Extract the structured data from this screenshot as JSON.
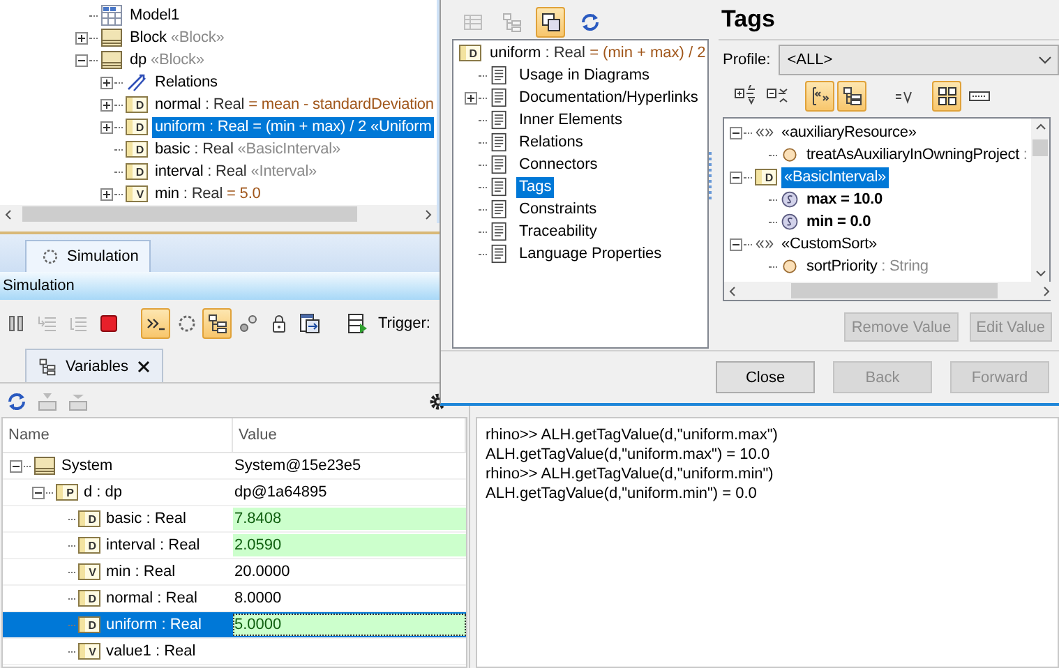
{
  "model_tree": {
    "items": [
      {
        "kind": "diagram",
        "name": "Model1",
        "selected": false
      },
      {
        "kind": "block",
        "name": "Block",
        "stereotype": "«Block»",
        "expanded": false,
        "selected": false
      },
      {
        "kind": "block",
        "name": "dp",
        "stereotype": "«Block»",
        "expanded": true,
        "selected": false,
        "children": [
          {
            "kind": "relations",
            "name": "Relations",
            "expanded": false,
            "selected": false
          },
          {
            "kind": "property",
            "icon_letter": "D",
            "name": "normal",
            "type": ": Real",
            "default": "= mean - standardDeviation",
            "expanded": false,
            "selected": false
          },
          {
            "kind": "property",
            "icon_letter": "D",
            "name": "uniform",
            "type": ": Real",
            "default": "= (min + max) / 2",
            "stereotype": "«Uniform",
            "expanded": false,
            "selected": true
          },
          {
            "kind": "property",
            "icon_letter": "D",
            "name": "basic",
            "type": ": Real",
            "stereotype": "«BasicInterval»",
            "selected": false
          },
          {
            "kind": "property",
            "icon_letter": "D",
            "name": "interval",
            "type": ": Real",
            "stereotype": "«Interval»",
            "selected": false
          },
          {
            "kind": "property",
            "icon_letter": "V",
            "name": "min",
            "type": ": Real",
            "default": "= 5.0",
            "expanded": false,
            "selected": false
          }
        ]
      }
    ]
  },
  "simulation": {
    "tab": "Simulation",
    "title": "Simulation",
    "trigger_label": "Trigger:",
    "tools": [
      {
        "kind": "pause",
        "pressed": false,
        "disabled": false
      },
      {
        "kind": "step_into",
        "pressed": false,
        "disabled": true
      },
      {
        "kind": "step_over",
        "pressed": false,
        "disabled": true
      },
      {
        "kind": "stop",
        "pressed": false,
        "disabled": false
      },
      {
        "kind": "console",
        "pressed": true,
        "disabled": false
      },
      {
        "kind": "animation",
        "pressed": false,
        "disabled": false
      },
      {
        "kind": "tree",
        "pressed": true,
        "disabled": false
      },
      {
        "kind": "breakpoints",
        "pressed": false,
        "disabled": false
      },
      {
        "kind": "lock",
        "pressed": false,
        "disabled": false
      },
      {
        "kind": "export",
        "pressed": false,
        "disabled": false
      },
      {
        "kind": "run",
        "pressed": false,
        "disabled": false
      }
    ]
  },
  "variables": {
    "tab": "Variables",
    "columns": [
      "Name",
      "Value"
    ],
    "rows": [
      {
        "kind": "block",
        "name": "System",
        "value": "System@15e23e5",
        "expanded": true,
        "changed": false,
        "selected": false,
        "children": [
          {
            "kind": "property",
            "icon_letter": "P",
            "name": "d : dp",
            "value": "dp@1a64895",
            "expanded": true,
            "changed": false,
            "selected": false,
            "children": [
              {
                "kind": "property",
                "icon_letter": "D",
                "name": "basic : Real",
                "value": "7.8408",
                "changed": true,
                "selected": false
              },
              {
                "kind": "property",
                "icon_letter": "D",
                "name": "interval : Real",
                "value": "2.0590",
                "changed": true,
                "selected": false
              },
              {
                "kind": "property",
                "icon_letter": "V",
                "name": "min : Real",
                "value": "20.0000",
                "changed": false,
                "selected": false
              },
              {
                "kind": "property",
                "icon_letter": "D",
                "name": "normal : Real",
                "value": "8.0000",
                "changed": false,
                "selected": false
              },
              {
                "kind": "property",
                "icon_letter": "D",
                "name": "uniform : Real",
                "value": "5.0000",
                "changed": true,
                "selected": true
              },
              {
                "kind": "property",
                "icon_letter": "V",
                "name": "value1 : Real",
                "changed": false,
                "selected": false
              }
            ]
          }
        ]
      }
    ]
  },
  "console": {
    "lines": [
      "rhino>> ALH.getTagValue(d,\"uniform.max\")",
      "ALH.getTagValue(d,\"uniform.max\") = 10.0",
      "rhino>> ALH.getTagValue(d,\"uniform.min\")",
      "ALH.getTagValue(d,\"uniform.min\") = 0.0"
    ]
  },
  "dialog": {
    "tools": [
      {
        "kind": "table",
        "pressed": false,
        "disabled": true
      },
      {
        "kind": "tree",
        "pressed": false,
        "disabled": true
      },
      {
        "kind": "copy",
        "pressed": true,
        "disabled": false
      },
      {
        "kind": "refresh",
        "pressed": false,
        "disabled": false
      }
    ],
    "nav": {
      "root": {
        "icon_letter": "D",
        "name": "uniform",
        "type": ": Real",
        "default": "= (min + max) / 2"
      },
      "items": [
        {
          "label": "Usage in Diagrams",
          "selected": false
        },
        {
          "label": "Documentation/Hyperlinks",
          "expanded": false,
          "selected": false
        },
        {
          "label": "Inner Elements",
          "selected": false
        },
        {
          "label": "Relations",
          "selected": false
        },
        {
          "label": "Connectors",
          "selected": false
        },
        {
          "label": "Tags",
          "selected": true
        },
        {
          "label": "Constraints",
          "selected": false
        },
        {
          "label": "Traceability",
          "selected": false
        },
        {
          "label": "Language Properties",
          "selected": false
        }
      ]
    },
    "panel": {
      "title": "Tags",
      "profile_label": "Profile:",
      "profile": "<ALL>",
      "tools": [
        {
          "kind": "expand_all",
          "pressed": false
        },
        {
          "kind": "collapse_all",
          "pressed": false
        },
        {
          "kind": "stereotypes",
          "pressed": true
        },
        {
          "kind": "group",
          "pressed": true
        },
        {
          "kind": "values",
          "pressed": false
        },
        {
          "kind": "grid",
          "pressed": true
        },
        {
          "kind": "compact",
          "pressed": false
        }
      ],
      "tags": [
        {
          "kind": "stereotype",
          "label": "«auxiliaryResource»",
          "expanded": true,
          "selected": false,
          "children": [
            {
              "kind": "tag",
              "name": "treatAsAuxiliaryInOwningProject",
              "type": ":",
              "selected": false
            }
          ]
        },
        {
          "kind": "element_stereotype",
          "icon_letter": "D",
          "label": "«BasicInterval»",
          "expanded": true,
          "selected": true,
          "children": [
            {
              "kind": "slot",
              "name": "max = 10.0",
              "selected": false
            },
            {
              "kind": "slot",
              "name": "min = 0.0",
              "selected": false
            }
          ]
        },
        {
          "kind": "stereotype",
          "label": "«CustomSort»",
          "expanded": true,
          "selected": false,
          "children": [
            {
              "kind": "tag",
              "name": "sortPriority",
              "type": ": String",
              "selected": false
            }
          ]
        }
      ],
      "actions": [
        {
          "label": "Remove Value",
          "disabled": true
        },
        {
          "label": "Edit Value",
          "disabled": true
        }
      ]
    },
    "buttons": [
      {
        "label": "Close",
        "disabled": false
      },
      {
        "label": "Back",
        "disabled": true
      },
      {
        "label": "Forward",
        "disabled": true
      }
    ]
  }
}
